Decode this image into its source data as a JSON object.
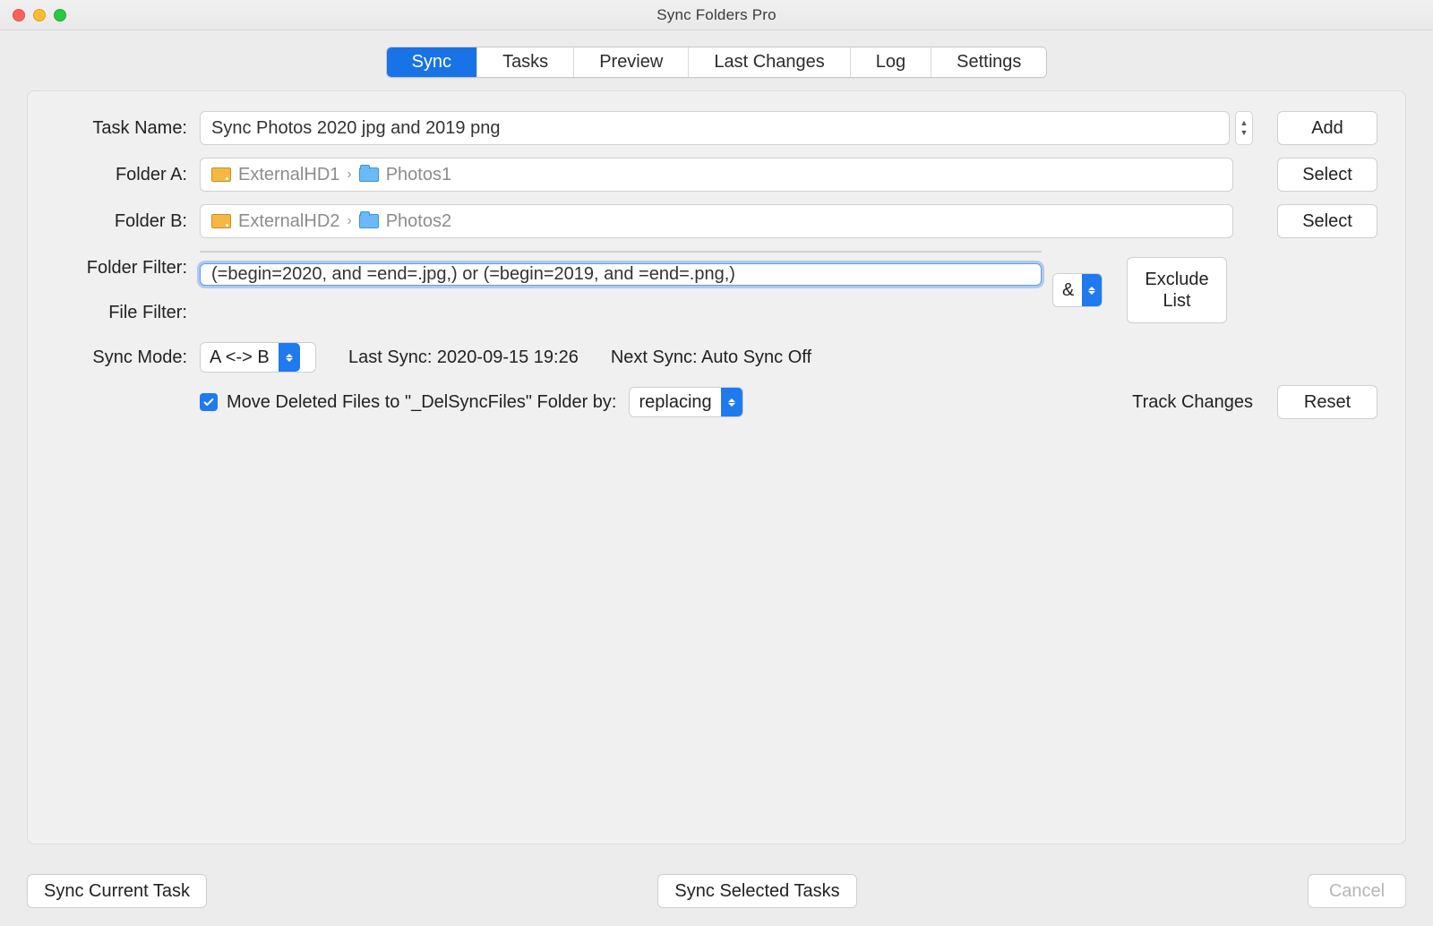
{
  "window": {
    "title": "Sync Folders Pro"
  },
  "tabs": {
    "items": [
      "Sync",
      "Tasks",
      "Preview",
      "Last Changes",
      "Log",
      "Settings"
    ],
    "active": 0
  },
  "form": {
    "task_name_label": "Task Name:",
    "task_name_value": "Sync Photos 2020 jpg and 2019 png",
    "add_button": "Add",
    "folder_a_label": "Folder A:",
    "folder_a_drive": "ExternalHD1",
    "folder_a_folder": "Photos1",
    "folder_b_label": "Folder B:",
    "folder_b_drive": "ExternalHD2",
    "folder_b_folder": "Photos2",
    "select_button": "Select",
    "folder_filter_label": "Folder Filter:",
    "folder_filter_value": "",
    "file_filter_label": "File Filter:",
    "file_filter_value": "(=begin=2020, and =end=.jpg,) or (=begin=2019, and =end=.png,)",
    "and_symbol": "&",
    "exclude_list_button": "Exclude\nList",
    "sync_mode_label": "Sync Mode:",
    "sync_mode_value": "A <-> B",
    "last_sync": "Last Sync: 2020-09-15 19:26",
    "next_sync": "Next Sync: Auto Sync Off",
    "move_deleted_checked": true,
    "move_deleted_label": "Move Deleted Files to \"_DelSyncFiles\" Folder by:",
    "replacing_value": "replacing",
    "track_changes": "Track Changes",
    "reset_button": "Reset"
  },
  "footer": {
    "sync_current": "Sync Current Task",
    "sync_selected": "Sync Selected Tasks",
    "cancel": "Cancel"
  }
}
